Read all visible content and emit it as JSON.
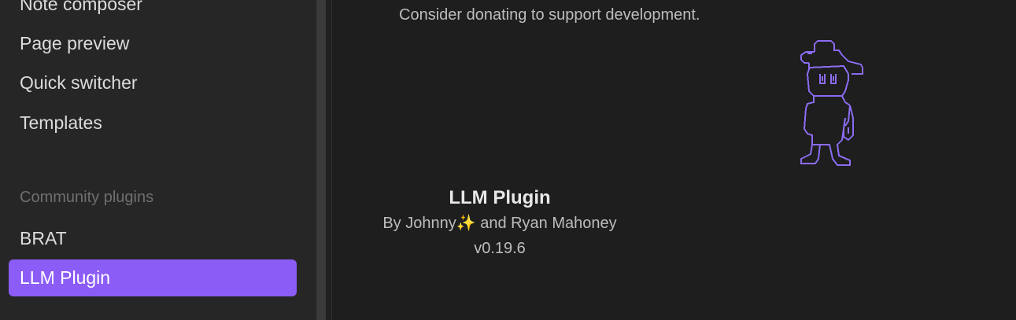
{
  "sidebar": {
    "items": [
      {
        "label": "Note composer"
      },
      {
        "label": "Page preview"
      },
      {
        "label": "Quick switcher"
      },
      {
        "label": "Templates"
      }
    ],
    "community_header": "Community plugins",
    "community_items": [
      {
        "label": "BRAT"
      },
      {
        "label": "LLM Plugin"
      }
    ],
    "active_item": "LLM Plugin",
    "accent_color": "#8b5cf6"
  },
  "main": {
    "donate_text": "Consider donating to support development.",
    "mascot_icon": "pixel-character-with-hat-icon",
    "plugin_title": "LLM Plugin",
    "plugin_authors": "By Johnny✨ and Ryan Mahoney",
    "plugin_version": "v0.19.6"
  }
}
